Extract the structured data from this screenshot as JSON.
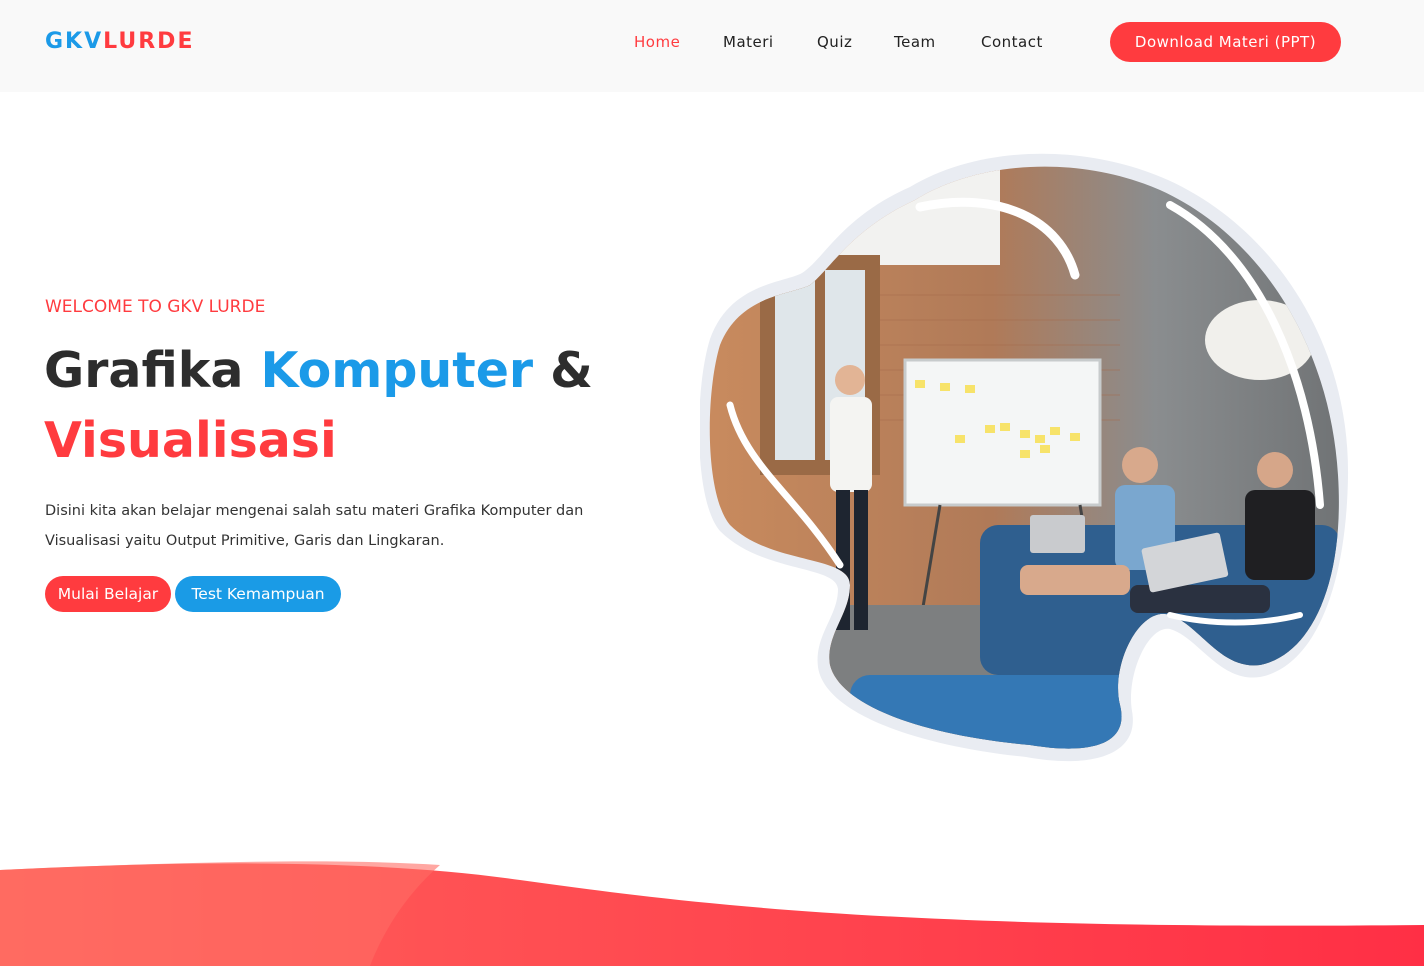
{
  "header": {
    "logo_part1": "GKV",
    "logo_part2": "LURDE",
    "nav": [
      "Home",
      "Materi",
      "Quiz",
      "Team",
      "Contact"
    ],
    "active_nav": "Home",
    "cta_label": "Download Materi (PPT)"
  },
  "hero": {
    "eyebrow": "WELCOME TO GKV LURDE",
    "title_word1": "Grafika",
    "title_word2": "Komputer",
    "title_amp": "&",
    "title_line2": "Visualisasi",
    "description": "Disini kita akan belajar mengenai salah satu materi Grafika Komputer dan Visualisasi yaitu Output Primitive, Garis dan Lingkaran.",
    "button_start": "Mulai Belajar",
    "button_test": "Test Kemampuan"
  },
  "colors": {
    "accent_red": "#ff3b3f",
    "accent_blue": "#1b9ae8",
    "header_bg": "#f9f9f9"
  }
}
